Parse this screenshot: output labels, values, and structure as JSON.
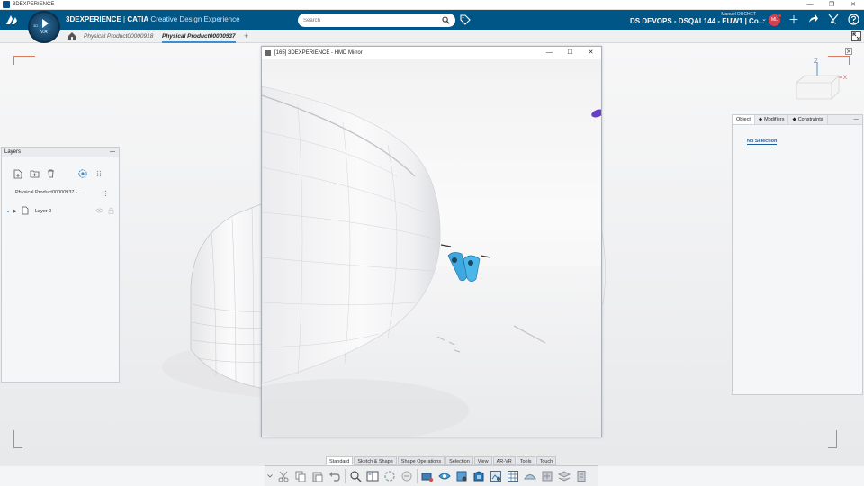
{
  "os": {
    "title": "3DEXPERIENCE",
    "controls": [
      "—",
      "❐",
      "✕"
    ]
  },
  "topbar": {
    "brand_strong": "3DEXPERIENCE",
    "brand_sep": " | ",
    "brand_app": "CATIA",
    "brand_sub": " Creative Design Experience",
    "compass_version": "V.R",
    "compass_num": "3D",
    "search_placeholder": "Search",
    "user_name": "Manuel DUCHET",
    "tenant": "DS DEVOPS - DSQAL144 - EUW1 | Co...",
    "avatar_initials": "ML"
  },
  "tabs": [
    {
      "label": "Physical Product00000918"
    },
    {
      "label": "Physical Product00000937"
    }
  ],
  "tab_add": "+",
  "layers": {
    "title": "Layers",
    "minimize": "—",
    "root_label": "Physical Product00000937 -...",
    "row_label": "Layer 0"
  },
  "props": {
    "tabs": [
      "Object",
      "Modifiers",
      "Constraints"
    ],
    "minimize": "—",
    "no_selection": "No Selection"
  },
  "viewcube": {
    "z_label": "Z",
    "x_label": "X"
  },
  "hmd": {
    "title": "[165] 3DEXPERIENCE - HMD Mirror",
    "controls": [
      "—",
      "☐",
      "✕"
    ]
  },
  "command_tabs": [
    "Standard",
    "Sketch & Shape",
    "Shape Operations",
    "Selection",
    "View",
    "AR-VR",
    "Tools",
    "Touch"
  ],
  "active_command_tab": "Standard",
  "colors": {
    "brand_blue": "#005686",
    "accent_blue": "#3b8fd0",
    "avatar_red": "#d9404f",
    "frame_orange": "#e07a5f",
    "vr_controller": "#3ea9e0",
    "purple_object": "#6a3fc7"
  }
}
